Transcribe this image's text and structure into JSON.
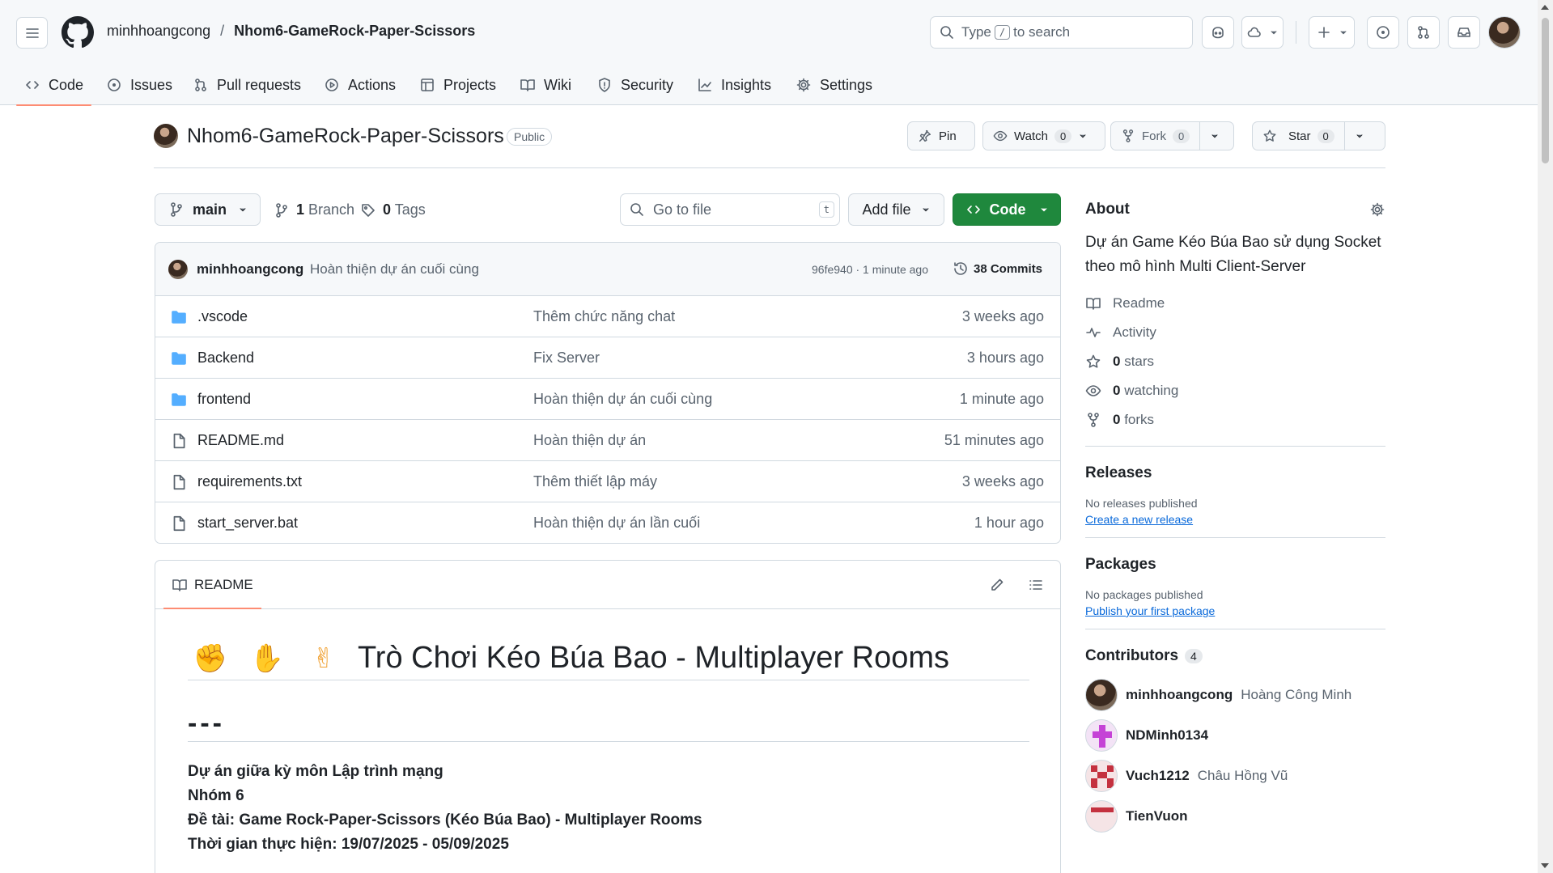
{
  "header": {
    "owner": "minhhoangcong",
    "separator": "/",
    "repo": "Nhom6-GameRock-Paper-Scissors",
    "search_prefix": "Type",
    "search_key": "/",
    "search_suffix": "to search"
  },
  "tabs": [
    {
      "label": "Code",
      "icon": "code-icon"
    },
    {
      "label": "Issues",
      "icon": "issue-icon"
    },
    {
      "label": "Pull requests",
      "icon": "pull-request-icon"
    },
    {
      "label": "Actions",
      "icon": "play-icon"
    },
    {
      "label": "Projects",
      "icon": "table-icon"
    },
    {
      "label": "Wiki",
      "icon": "book-icon"
    },
    {
      "label": "Security",
      "icon": "shield-icon"
    },
    {
      "label": "Insights",
      "icon": "graph-icon"
    },
    {
      "label": "Settings",
      "icon": "gear-icon"
    }
  ],
  "repo_header": {
    "name": "Nhom6-GameRock-Paper-Scissors",
    "visibility": "Public",
    "pin": "Pin",
    "watch": "Watch",
    "watch_count": "0",
    "fork": "Fork",
    "fork_count": "0",
    "star": "Star",
    "star_count": "0"
  },
  "filenav": {
    "branch": "main",
    "branch_count": "1",
    "branch_label": "Branch",
    "tag_count": "0",
    "tag_label": "Tags",
    "goto_placeholder": "Go to file",
    "goto_key": "t",
    "add_file": "Add file",
    "code": "Code"
  },
  "last_commit": {
    "user": "minhhoangcong",
    "message": "Hoàn thiện dự án cuối cùng",
    "hash_time": "96fe940 · 1 minute ago",
    "commits": "38 Commits"
  },
  "files": [
    {
      "type": "folder",
      "name": ".vscode",
      "message": "Thêm chức năng chat",
      "date": "3 weeks ago"
    },
    {
      "type": "folder",
      "name": "Backend",
      "message": "Fix Server",
      "date": "3 hours ago"
    },
    {
      "type": "folder",
      "name": "frontend",
      "message": "Hoàn thiện dự án cuối cùng",
      "date": "1 minute ago"
    },
    {
      "type": "file",
      "name": "README.md",
      "message": "Hoàn thiện dự án",
      "date": "51 minutes ago"
    },
    {
      "type": "file",
      "name": "requirements.txt",
      "message": "Thêm thiết lập máy",
      "date": "3 weeks ago"
    },
    {
      "type": "file",
      "name": "start_server.bat",
      "message": "Hoàn thiện dự án lần cuối",
      "date": "1 hour ago"
    }
  ],
  "readme": {
    "tab": "README",
    "emoji": [
      "✊",
      "✋",
      "✌"
    ],
    "title": "Trò Chơi Kéo Búa Bao - Multiplayer Rooms",
    "hr": "---",
    "lines": [
      "Dự án giữa kỳ môn Lập trình mạng",
      "Nhóm 6",
      "Đề tài: Game Rock-Paper-Scissors (Kéo Búa Bao) - Multiplayer Rooms",
      "Thời gian thực hiện: 19/07/2025 - 05/09/2025"
    ]
  },
  "about": {
    "title": "About",
    "description": "Dự án Game Kéo Búa Bao sử dụng Socket theo mô hình Multi Client-Server",
    "readme": "Readme",
    "activity": "Activity",
    "stars_count": "0",
    "stars_label": "stars",
    "watching_count": "0",
    "watching_label": "watching",
    "forks_count": "0",
    "forks_label": "forks"
  },
  "releases": {
    "title": "Releases",
    "empty": "No releases published",
    "link": "Create a new release"
  },
  "packages": {
    "title": "Packages",
    "empty": "No packages published",
    "link": "Publish your first package"
  },
  "contributors": {
    "title": "Contributors",
    "count": "4",
    "list": [
      {
        "login": "minhhoangcong",
        "name": "Hoàng Công Minh"
      },
      {
        "login": "NDMinh0134",
        "name": ""
      },
      {
        "login": "Vuch1212",
        "name": "Châu Hồng Vũ"
      },
      {
        "login": "TienVuon",
        "name": ""
      }
    ]
  },
  "colors": {
    "accent_green": "#1f883d",
    "tab_underline": "#fd8c73",
    "link_blue": "#0969da",
    "folder_blue": "#54aeff"
  }
}
